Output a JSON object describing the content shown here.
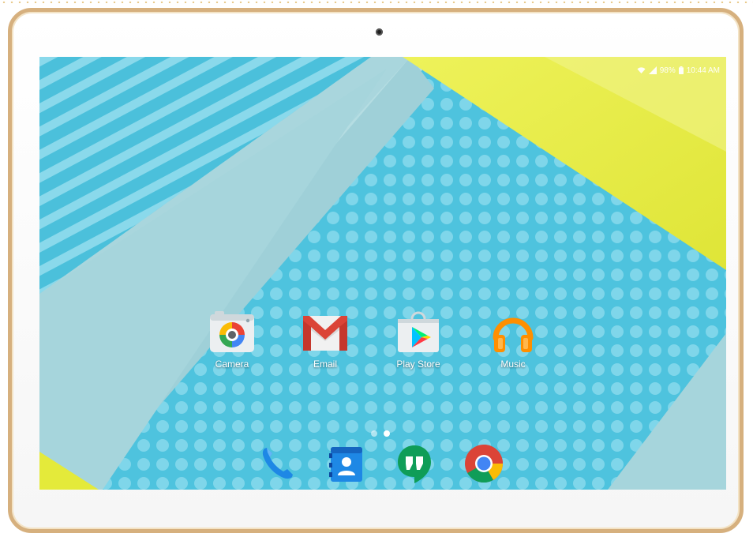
{
  "status_bar": {
    "battery_percent": "98%",
    "time": "10:44 AM",
    "icons": [
      "wifi-icon",
      "signal-icon",
      "battery-icon"
    ]
  },
  "home_apps": [
    {
      "label": "Camera",
      "icon": "camera-icon"
    },
    {
      "label": "Email",
      "icon": "gmail-icon"
    },
    {
      "label": "Play Store",
      "icon": "play-store-icon"
    },
    {
      "label": "Music",
      "icon": "headphones-icon"
    }
  ],
  "page_indicator": {
    "pages": 2,
    "current_page": 2
  },
  "dock": [
    {
      "icon": "phone-icon"
    },
    {
      "icon": "contacts-icon"
    },
    {
      "icon": "hangouts-icon"
    },
    {
      "icon": "chrome-icon"
    }
  ],
  "colors": {
    "frame_gold": "#d6b07e",
    "wallpaper_blue": "#53c6e0",
    "wallpaper_pale": "#a9d6dd",
    "wallpaper_yellow": "#e7ed3d"
  }
}
